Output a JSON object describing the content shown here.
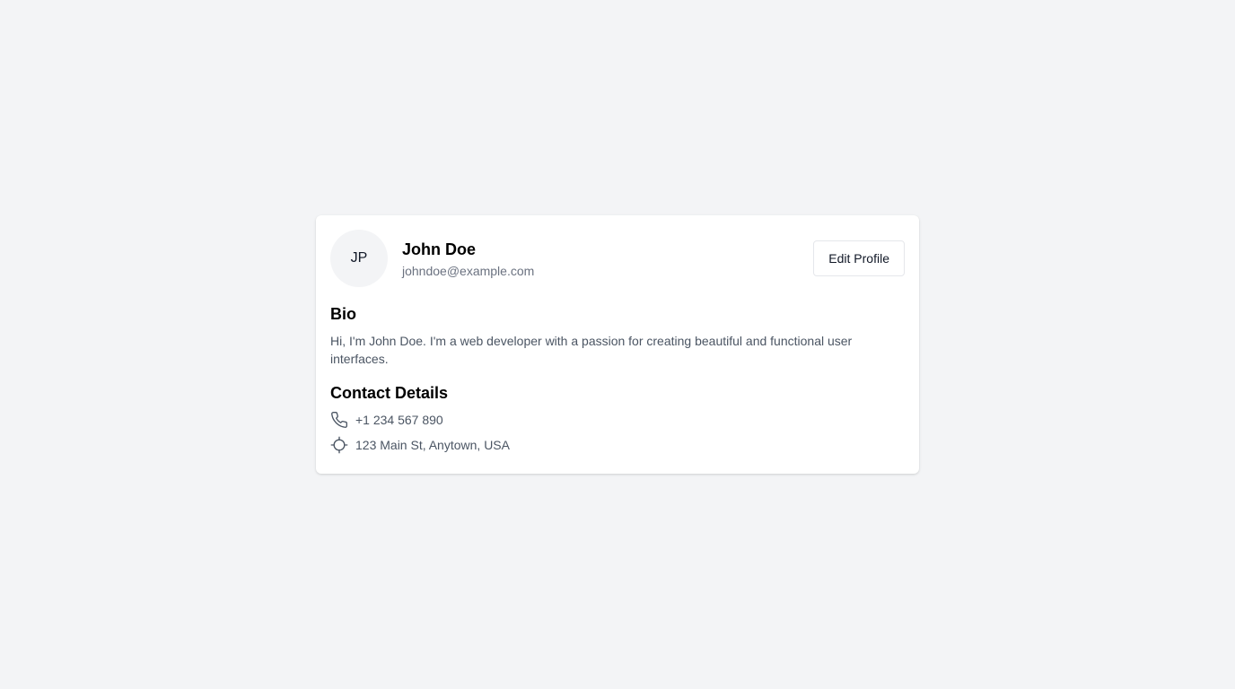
{
  "profile": {
    "initials": "JP",
    "name": "John Doe",
    "email": "johndoe@example.com",
    "edit_label": "Edit Profile"
  },
  "bio": {
    "title": "Bio",
    "text": "Hi, I'm John Doe. I'm a web developer with a passion for creating beautiful and functional user interfaces."
  },
  "contact": {
    "title": "Contact Details",
    "items": [
      {
        "icon": "phone-icon",
        "text": "+1 234 567 890"
      },
      {
        "icon": "location-icon",
        "text": "123 Main St, Anytown, USA"
      }
    ]
  },
  "colors": {
    "page_bg": "#f3f4f6",
    "card_bg": "#ffffff",
    "muted_text": "#6b7280",
    "body_text": "#4b5563"
  }
}
